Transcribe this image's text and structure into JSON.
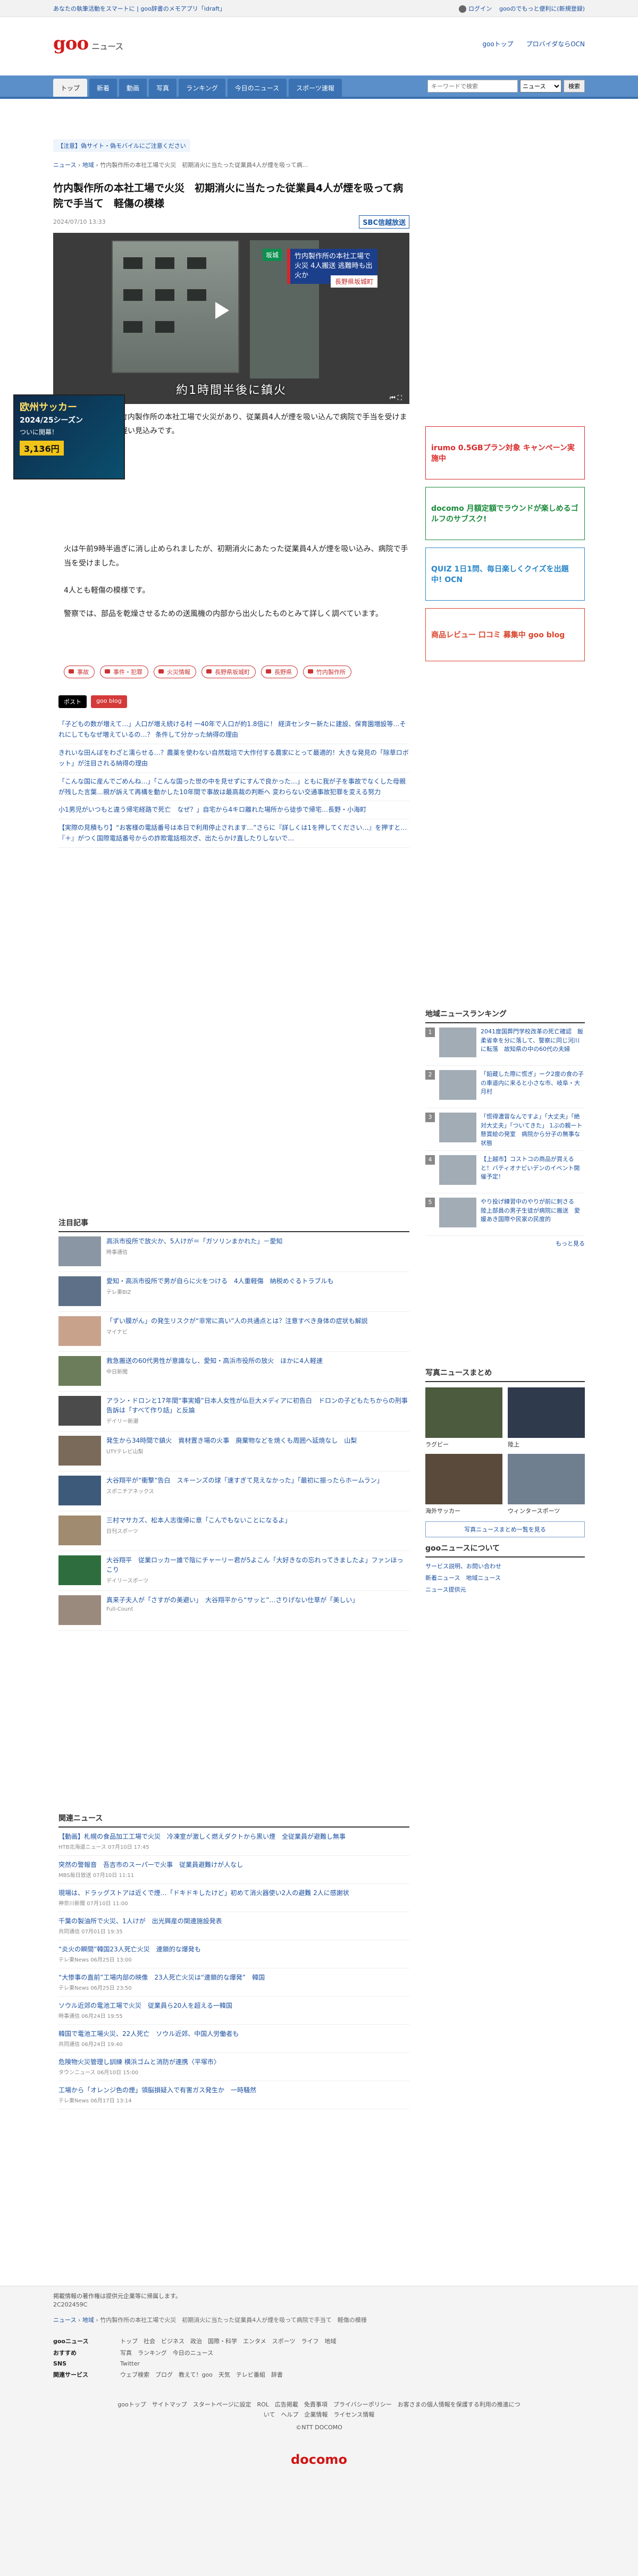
{
  "topbar": {
    "left": "あなたの執筆活動をスマートに | goo辞書のメモアプリ「idraft」",
    "login": "ログイン",
    "promo": "gooのでもっと便利に(新規登録)"
  },
  "header": {
    "logo": "goo",
    "logo_sub": "ニュース",
    "links": [
      "gooトップ",
      "プロバイダならOCN"
    ]
  },
  "gnav": {
    "tabs": [
      "トップ",
      "新着",
      "動画",
      "写真",
      "ランキング",
      "今日のニュース",
      "スポーツ速報"
    ],
    "search_placeholder": "キーワードで検索",
    "search_scope": "ニュース",
    "search_button": "検索"
  },
  "article": {
    "promo": "【注意】偽サイト・偽モバイルにご注意ください",
    "crumb": [
      "ニュース",
      "地域",
      "竹内製作所の本社工場で火災　初期消火に当たった従業員4人が煙を吸って病..."
    ],
    "title": "竹内製作所の本社工場で火災　初期消火に当たった従業員4人が煙を吸って病院で手当て　軽傷の模様",
    "date": "2024/07/10 13:33",
    "source": "SBC信越放送",
    "video": {
      "badge": "坂城",
      "caption": "竹内製作所の本社工場で火災 4人搬送 逃難時も出火か",
      "sub": "長野県坂城町",
      "lower": "約1時間半後に鎮火",
      "ctrl": "⏮ ⛶"
    },
    "lead": "建設機械メーカー、竹内製作所の本社工場で火災があり、従業員4人が煙を吸い込んで病院で手当を受けました。けがの程度は軽い見込みです。",
    "body": [
      "火は午前9時半過ぎに消し止められましたが、初期消火にあたった従業員4人が煙を吸い込み、病院で手当を受けました。",
      "4人とも軽傷の模様です。",
      "警察では、部品を乾燥させるための送風機の内部から出火したものとみて詳しく調べています。"
    ],
    "tags": [
      "事故",
      "事件・犯罪",
      "火災情報",
      "長野県坂城町",
      "長野県",
      "竹内製作所"
    ],
    "share": [
      "ポスト",
      "goo blog"
    ],
    "related": [
      "「子どもの数が増えて…」人口が増え続ける村 一40年で人口が約1.8倍に！ 経済センター新たに建設、保育園増設等…それにしてもなぜ増えているの…？ 条件して分かった納得の理由",
      "きれいな田んぼをわざと濡らせる…？農薬を使わない自然栽培で大作付する農家にとって最適的！大きな発見の「除草ロボット」が注目される納得の理由",
      "「こんな国に産んでごめんね…」「こんな国った世の中を見せずにすんで良かった…」ともに我が子を事故でなくした母親が残した言葉…親が訴えて再構を動かした10年間で事故は最高裁の判断へ 変わらない交通事故犯罪を変える努力",
      "小1男児がいつもと違う帰宅経路で死亡　なぜ？」自宅から4キロ離れた場所から徒歩で帰宅…長野・小海町",
      "【実際の見積もり】“お客様の電話番号は本日で利用停止されます…”さらに『詳しくは1を押してください…』を押すと…『＋』がつく国際電話番号からの詐欺電話相次ぎ、出たらかけ直したりしないで…"
    ]
  },
  "attention": {
    "title": "注目記事",
    "items": [
      {
        "t": "高浜市役所で放火か、5人けが＝「ガソリンまかれた」－愛知",
        "s": "時事通信"
      },
      {
        "t": "愛知・高浜市役所で男が自らに火をつける　4人重軽傷　納税めぐるトラブルも",
        "s": "テレ東BIZ"
      },
      {
        "t": "「ずい膜がん」の発生リスクが“非常に高い”人の共通点とは？注意すべき身体の症状も解説",
        "s": "マイナビ"
      },
      {
        "t": "救急搬送の60代男性が意識なし、愛知・高浜市役所の放火　ほかに4人軽速",
        "s": "中日新聞"
      },
      {
        "t": "アラン・ドロンと17年間“事実婚”日本人女性が仏巨大メディアに初告白　ドロンの子どもたちからの刑事告訴は「すべて作り話」と反論",
        "s": "デイリー新潮"
      },
      {
        "t": "発生から34時間で鎮火　資材置き場の火事　廃棄物などを焼くも周囲へ延焼なし　山梨",
        "s": "UTYテレビ山梨"
      },
      {
        "t": "大谷翔平が“衝撃”告白　スキーンズの球「速すぎて見えなかった」「最初に振ったらホームラン」",
        "s": "スポニチアネックス"
      },
      {
        "t": "三村マサカズ、松本人志復帰に意「こんでもないことになるよ」",
        "s": "日刊スポーツ"
      },
      {
        "t": "大谷翔平　従業ロッカー誰で陰にチャーリー君が5よこん「大好きなの忘れってきましたよ」ファンほっこり",
        "s": "デイリースポーツ"
      },
      {
        "t": "真来子夫人が「さすがの美避い」　大谷翔平から“サッと”…さりげない仕草が「美しい」",
        "s": "Full-Count"
      }
    ]
  },
  "relnews": {
    "title": "関連ニュース",
    "items": [
      {
        "t": "【動画】札幌の食品加工工場で火災　冷凍室が激しく燃えダクトから黒い煙　全従業員が避難し無事",
        "s": "HTB北海道ニュース 07月10日 17:45"
      },
      {
        "t": "突然の警報音　吾吉市のスーパーで火事　従業員避難けが人なし",
        "s": "MBS毎日放送 07月10日 11:11"
      },
      {
        "t": "現場は、ドラッグストアは近くで煙…「ドキドキしたけど」初めて消火器使い2人の避難 2人に感謝状",
        "s": "神奈川新聞 07月10日 11:00"
      },
      {
        "t": "千葉の製油所で火災、1人けが　出光興産の関連施設発表",
        "s": "共同通信 07月01日 19:35"
      },
      {
        "t": "“炎火の瞬間”韓国23人死亡火災　連鎖的な爆発も",
        "s": "テレ東News 06月25日 13:00"
      },
      {
        "t": "“大惨事の直前”工場内部の映像　23人死亡火災は“連鎖的な爆発”　韓国",
        "s": "テレ東News 06月25日 23:50"
      },
      {
        "t": "ソウル近郊の電池工場で火災　従業員ら20人を超える一韓国",
        "s": "時事通信 06月24日 19:55"
      },
      {
        "t": "韓国で電池工場火災、22人死亡　ソウル近郊、中国人労働者も",
        "s": "共同通信 06月24日 19:40"
      },
      {
        "t": "危険物火災管理し訓練 横浜ゴムと消防が連携〈平塚市〉",
        "s": "タウンニュース 06月10日 15:00"
      },
      {
        "t": "工場から「オレンジ色の煙」領脳損疑入で有害ガス発生か　一時騒然",
        "s": "テレ東News 06月17日 13:14"
      }
    ]
  },
  "side": {
    "ads": [
      {
        "t": "irumo 0.5GBプラン対象 キャンペーン実施中",
        "c": "#d92b2b"
      },
      {
        "t": "docomo 月額定額でラウンドが楽しめるゴルフのサブスク!",
        "c": "#1b8a3b"
      },
      {
        "t": "QUIZ 1日1問、毎日楽しくクイズを出題中! OCN",
        "c": "#2c87c9"
      },
      {
        "t": "商品レビュー 口コミ 募集中 goo blog",
        "c": "#d9442b"
      }
    ],
    "ranking": {
      "title": "地域ニュースランキング",
      "items": [
        "2041度国葬門学校改革の死亡確認　飯柔省幸を分に落して、警察に同じ河川に転落　故知県の中の60代の夫婦",
        "「鉛蔵した際に慌ぎ」ーク2度の食の子の車道内に来ると小さな市、岐阜・大月村",
        "「慌得濃冒なんですよ」「大丈夫」「絶対大丈夫」「ついてきた」 1ぶの親ート懸賞絵の発室　病院から分子の無事な状態",
        "【上越市】コストコの商品が買えると！バティオナビいデンのイベント開催予定！",
        "やり投げ練習中のやりが前に刺さる　陸上部員の男子生徒が病院に搬送　愛媛あき国際や民家の民度的"
      ],
      "more": "もっと見る"
    },
    "photos": {
      "title": "写真ニュースまとめ",
      "labels": [
        "ラグビー",
        "陸上",
        "海外サッカー",
        "ウィンタースポーツ"
      ],
      "more": "写真ニュースまとめ一覧を見る"
    },
    "about": {
      "title": "gooニュースについて",
      "links": [
        "サービス説明、お問い合わせ",
        "新着ニュース　地域ニュース",
        "ニュース提供元"
      ]
    }
  },
  "floatad": {
    "t1": "欧州サッカー",
    "t2": "2024/25シーズン",
    "t3": "ついに開幕！",
    "price": "3,136円"
  },
  "footer": {
    "note": "掲載情報の著作権は提供元企業等に帰属します。",
    "code": "2C202459C",
    "crumb": [
      "ニュース",
      "地域",
      "竹内製作所の本社工場で火災　初期消火に当たった従業員4人が煙を吸って病院で手当て　軽傷の模様"
    ],
    "rows": [
      {
        "h": "gooニュース",
        "l": "トップ　社会　ビジネス　政治　国際・科学　エンタメ　スポーツ　ライフ　地域"
      },
      {
        "h": "おすすめ",
        "l": "写真　ランキング　今日のニュース"
      },
      {
        "h": "SNS",
        "l": "Twitter"
      },
      {
        "h": "関連サービス",
        "l": "ウェブ検索　ブログ　教えて！goo　天気　テレビ番組　辞書"
      }
    ],
    "links": "gooトップ　サイトマップ　スタートページに設定　ROL　広告掲載　免責事項　プライバシーポリシー　お客さまの個人情報を保護する利用の推進について　ヘルプ　企業情報　ライセンス情報",
    "copy": "©NTT DOCOMO",
    "brand": "docomo"
  }
}
